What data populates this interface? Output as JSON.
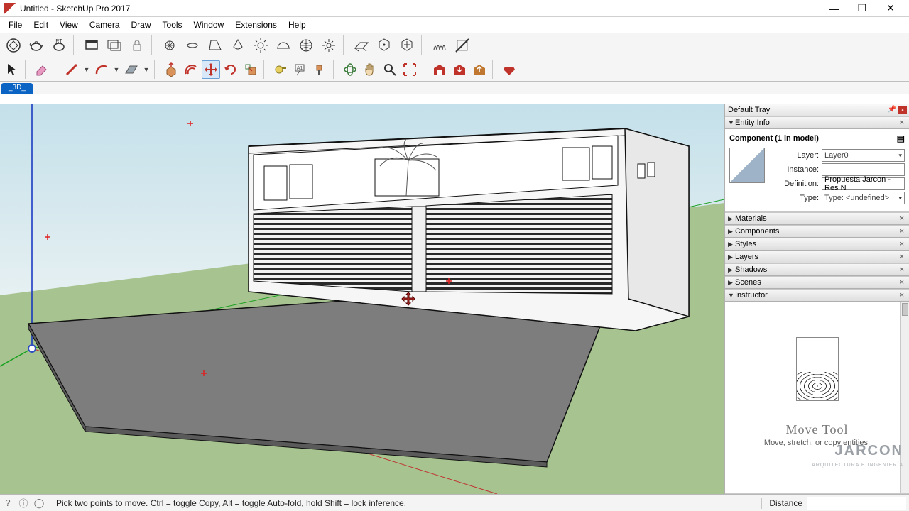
{
  "window": {
    "title": "Untitled - SketchUp Pro 2017"
  },
  "menu": [
    "File",
    "Edit",
    "View",
    "Camera",
    "Draw",
    "Tools",
    "Window",
    "Extensions",
    "Help"
  ],
  "tabs": [
    "_3D_"
  ],
  "tray": {
    "title": "Default Tray",
    "entity_info": {
      "header": "Entity Info",
      "component_label": "Component (1 in model)",
      "fields": {
        "layer_label": "Layer:",
        "layer_value": "Layer0",
        "instance_label": "Instance:",
        "instance_value": "",
        "definition_label": "Definition:",
        "definition_value": "Propuesta Jarcon - Res N",
        "type_label": "Type:",
        "type_value": "Type: <undefined>"
      }
    },
    "panels": [
      "Materials",
      "Components",
      "Styles",
      "Layers",
      "Shadows",
      "Scenes",
      "Instructor"
    ],
    "instructor": {
      "title": "Move Tool",
      "subtitle": "Move, stretch, or copy entities."
    }
  },
  "watermark": {
    "brand": "JARCON",
    "tagline": "ARQUITECTURA E INGENIERÍA"
  },
  "status": {
    "hint": "Pick two points to move.  Ctrl = toggle Copy, Alt = toggle Auto-fold, hold Shift = lock inference.",
    "distance_label": "Distance"
  }
}
